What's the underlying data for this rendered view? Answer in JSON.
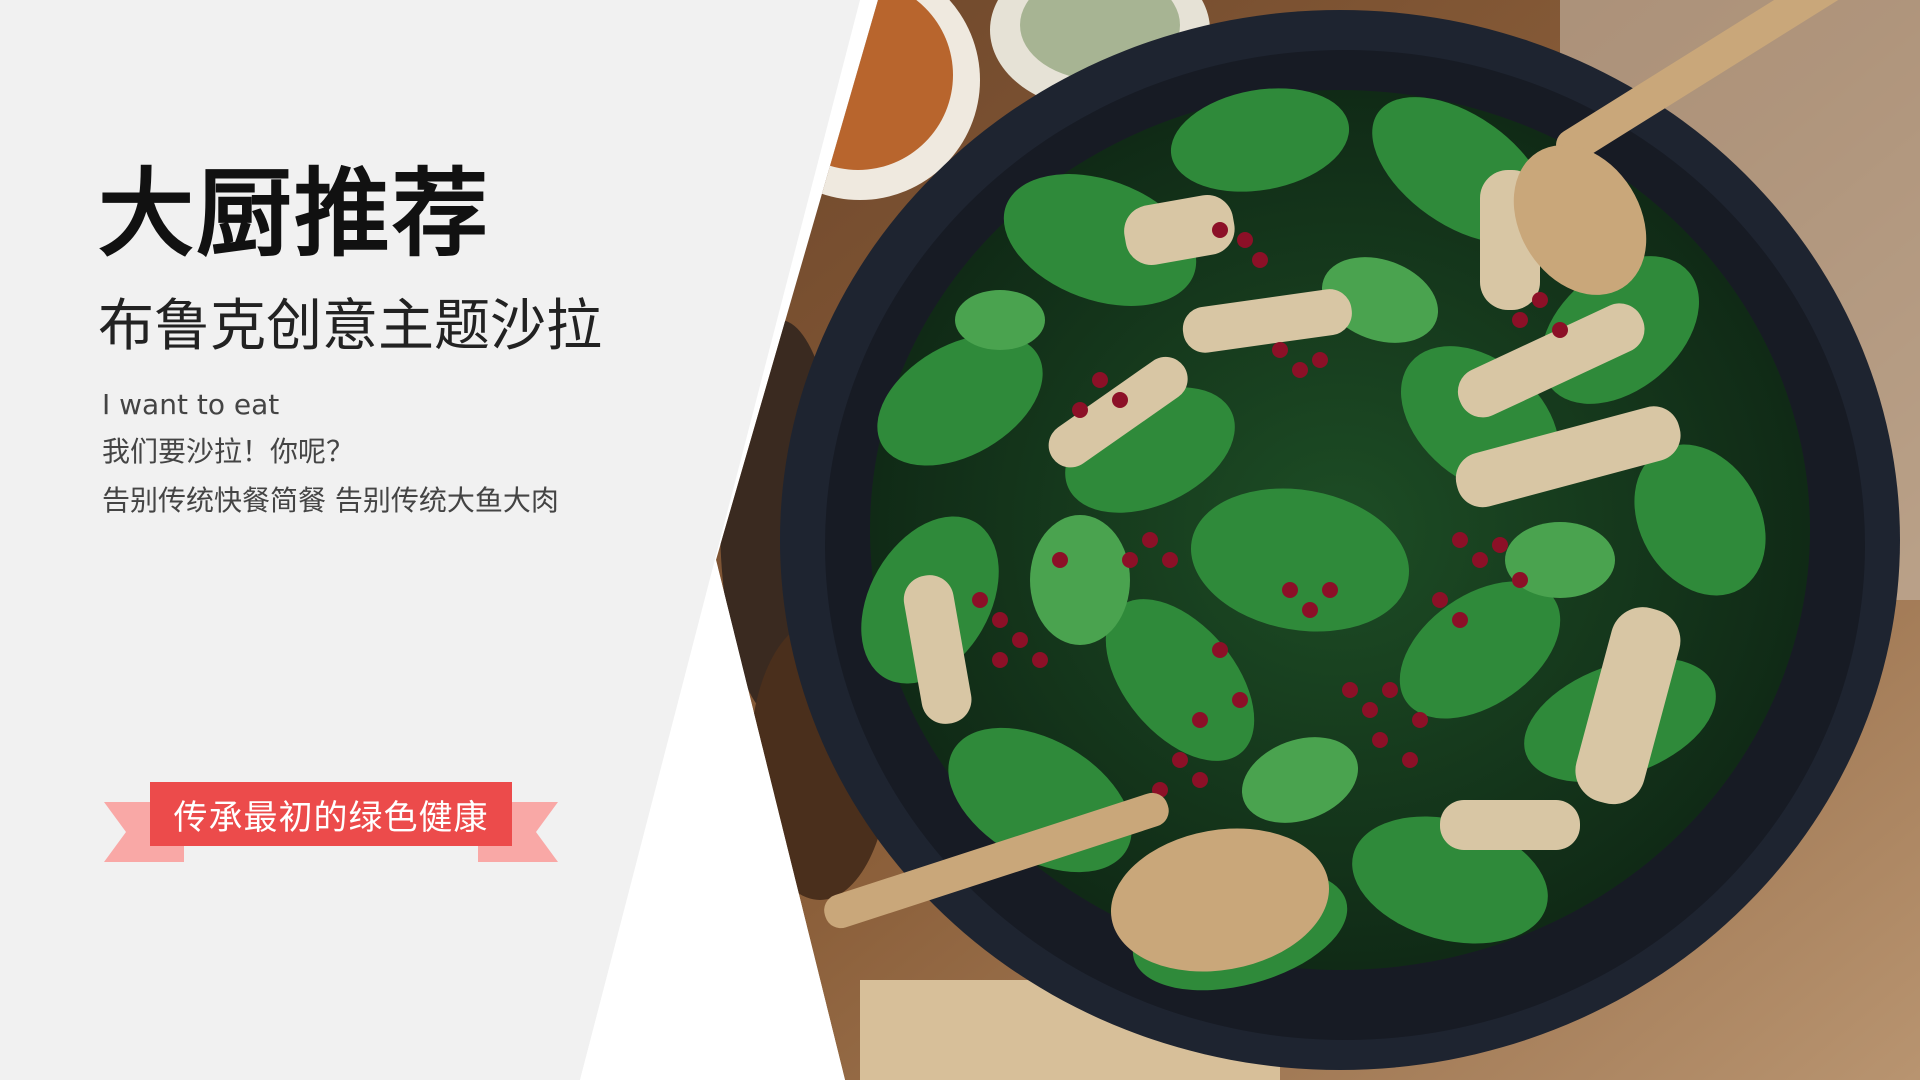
{
  "slide": {
    "title": "大厨推荐",
    "subtitle": "布鲁克创意主题沙拉",
    "lines": [
      "I want to eat",
      "我们要沙拉！你呢？",
      "告别传统快餐简餐 告别传统大鱼大肉"
    ],
    "ribbon_label": "传承最初的绿色健康"
  },
  "colors": {
    "panel_bg": "#f1f1f1",
    "ribbon": "#ec4b4b",
    "ribbon_tail": "#f9a8a6",
    "bowl": "#1e2430",
    "leaf": "#2f8a3a",
    "pomegranate": "#8c1027",
    "chicken": "#d8c6a4",
    "spoon": "#c9a77a"
  },
  "photo": {
    "subject": "salad-bowl-photo"
  }
}
